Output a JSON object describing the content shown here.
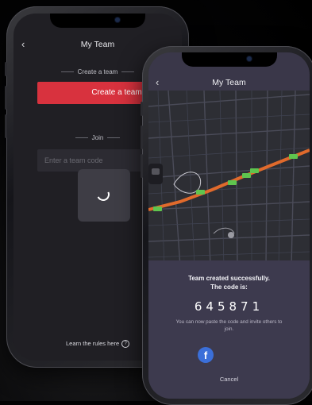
{
  "back_screen": {
    "title": "My Team",
    "create_section_label": "Create a team",
    "create_button_label": "Create a team",
    "join_section_label": "Join",
    "code_input_placeholder": "Enter a team code",
    "rules_link": "Learn the rules here",
    "loading": true
  },
  "front_screen": {
    "title": "My Team",
    "success_line_1": "Team created successfully.",
    "success_line_2": "The code is:",
    "team_code": "645871",
    "hint": "You can now paste the code and invite others to join.",
    "share_icon": "facebook-icon",
    "cancel_label": "Cancel"
  },
  "colors": {
    "accent_red": "#d8323e",
    "route_orange": "#e06a2c",
    "marker_green": "#5fc44e",
    "facebook_blue": "#3b6fd9"
  }
}
